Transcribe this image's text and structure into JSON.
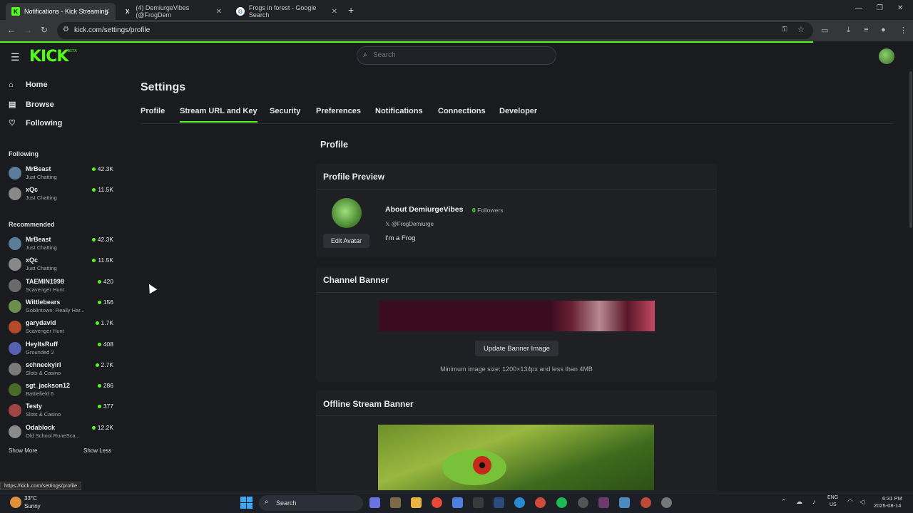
{
  "browser": {
    "tabs": [
      {
        "title": "Notifications - Kick Streaming",
        "fav": "K",
        "fav_color": "#53fc18"
      },
      {
        "title": "(4) DemiurgeVibes (@FrogDem",
        "fav": "X",
        "fav_color": "#000000"
      },
      {
        "title": "Frogs in forest - Google Search",
        "fav": "G",
        "fav_color": "#ffffff"
      }
    ],
    "url": "kick.com/settings/profile"
  },
  "header": {
    "logo": "KICK",
    "logo_badge": "BETA",
    "search_placeholder": "Search"
  },
  "sidebar": {
    "nav": [
      {
        "label": "Home",
        "icon": "⌂"
      },
      {
        "label": "Browse",
        "icon": "▤"
      },
      {
        "label": "Following",
        "icon": "♡"
      }
    ],
    "following_title": "Following",
    "following": [
      {
        "name": "MrBeast",
        "category": "Just Chatting",
        "viewers": "42.3K",
        "color": "#5a7d9a"
      },
      {
        "name": "xQc",
        "category": "Just Chatting",
        "viewers": "11.5K",
        "color": "#888888"
      }
    ],
    "recommended_title": "Recommended",
    "recommended": [
      {
        "name": "MrBeast",
        "category": "Just Chatting",
        "viewers": "42.3K",
        "color": "#5a7d9a"
      },
      {
        "name": "xQc",
        "category": "Just Chatting",
        "viewers": "11.5K",
        "color": "#888888"
      },
      {
        "name": "TAEMIN1998",
        "category": "Scavenger Hunt",
        "viewers": "420",
        "color": "#6a6a6a"
      },
      {
        "name": "Wittlebears",
        "category": "Goblintown: Really Har...",
        "viewers": "156",
        "color": "#6b8e4e"
      },
      {
        "name": "garydavid",
        "category": "Scavenger Hunt",
        "viewers": "1.7K",
        "color": "#b34a2a"
      },
      {
        "name": "HeyItsRuff",
        "category": "Grounded 2",
        "viewers": "408",
        "color": "#5560b0"
      },
      {
        "name": "schneckyirl",
        "category": "Slots & Casino",
        "viewers": "2.7K",
        "color": "#7a7a7a"
      },
      {
        "name": "sgt_jackson12",
        "category": "Battlefield 6",
        "viewers": "286",
        "color": "#4a6a2a"
      },
      {
        "name": "Testy",
        "category": "Slots & Casino",
        "viewers": "377",
        "color": "#a04444"
      },
      {
        "name": "Odablock",
        "category": "Old School RuneSca...",
        "viewers": "12.2K",
        "color": "#8a8a8a"
      }
    ],
    "show_more": "Show More",
    "show_less": "Show Less"
  },
  "settings": {
    "title": "Settings",
    "tabs": [
      "Profile",
      "Stream URL and Key",
      "Security",
      "Preferences",
      "Notifications",
      "Connections",
      "Developer"
    ],
    "section_title": "Profile",
    "preview": {
      "heading": "Profile Preview",
      "about": "About DemiurgeVibes",
      "followers_count": "0",
      "followers_label": "Followers",
      "x_handle": "@FrogDemiurge",
      "bio": "I'm a Frog",
      "edit_avatar": "Edit Avatar"
    },
    "banner": {
      "heading": "Channel Banner",
      "button": "Update Banner Image",
      "note": "Minimum image size: 1200×134px and less than 4MB"
    },
    "offline": {
      "heading": "Offline Stream Banner"
    }
  },
  "status_url": "https://kick.com/settings/profile",
  "taskbar": {
    "temp": "33°C",
    "weather": "Sunny",
    "search": "Search",
    "lang1": "ENG",
    "lang2": "US",
    "time": "6:31 PM",
    "date": "2025-08-14"
  },
  "colors": {
    "accent": "#53fc18",
    "background": "#191b1f",
    "card": "#1e2024"
  }
}
